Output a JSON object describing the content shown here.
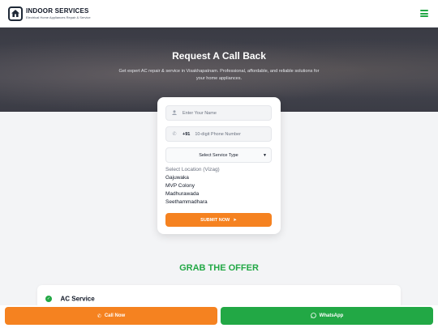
{
  "header": {
    "brand_title": "INDOOR SERVICES",
    "brand_subtitle": "Electrical Home Appliances Repair & Service",
    "logo_icon": "house-icon",
    "menu_icon": "hamburger-menu-icon",
    "accent_color": "#22a845"
  },
  "hero": {
    "title": "Request A Call Back",
    "description": "Get expert AC repair & service in Visakhapatnam. Professional, affordable, and reliable solutions for your home appliances."
  },
  "form": {
    "name_placeholder": "Enter Your Name",
    "phone_prefix": "+91",
    "phone_placeholder": "10-digit Phone Number",
    "service_select": "Select Service Type",
    "location_title": "Select Location (Vizag)",
    "locations": [
      "Gajuwaka",
      "MVP Colony",
      "Madhurawada",
      "Seethammadhara"
    ],
    "submit_label": "SUBMIT NOW",
    "submit_color": "#f58220"
  },
  "offer": {
    "heading": "GRAB THE OFFER"
  },
  "service": {
    "title": "AC Service"
  },
  "bottom_bar": {
    "call_label": "Call Now",
    "whatsapp_label": "WhatsApp",
    "call_color": "#f58220",
    "whatsapp_color": "#22a845"
  }
}
